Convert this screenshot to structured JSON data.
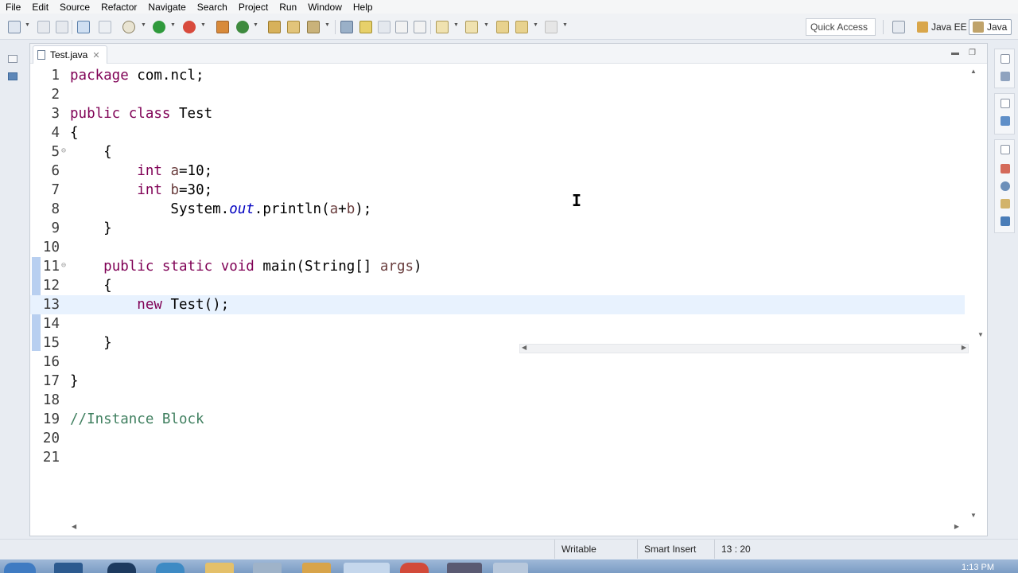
{
  "menu": [
    "File",
    "Edit",
    "Source",
    "Refactor",
    "Navigate",
    "Search",
    "Project",
    "Run",
    "Window",
    "Help"
  ],
  "toolbar": {
    "quick_access": "Quick Access",
    "perspectives": [
      "Java EE",
      "Java"
    ]
  },
  "editor": {
    "tab_label": "Test.java",
    "tab_close": "✕",
    "lines": [
      {
        "num": "1",
        "html": "<span class=\"kw\">package</span> com.ncl;"
      },
      {
        "num": "2",
        "html": ""
      },
      {
        "num": "3",
        "html": "<span class=\"kw\">public</span> <span class=\"kw\">class</span> Test"
      },
      {
        "num": "4",
        "html": "{"
      },
      {
        "num": "5",
        "html": "    {",
        "fold": "⊖"
      },
      {
        "num": "6",
        "html": "        <span class=\"kw\">int</span> <span class=\"var\">a</span>=10;"
      },
      {
        "num": "7",
        "html": "        <span class=\"kw\">int</span> <span class=\"var\">b</span>=30;"
      },
      {
        "num": "8",
        "html": "            System.<span class=\"fld\">out</span>.println(<span class=\"var\">a</span>+<span class=\"var\">b</span>);"
      },
      {
        "num": "9",
        "html": "    }"
      },
      {
        "num": "10",
        "html": ""
      },
      {
        "num": "11",
        "html": "    <span class=\"kw\">public</span> <span class=\"kw\">static</span> <span class=\"kw\">void</span> main(String[] <span class=\"var\">args</span>)",
        "fold": "⊖"
      },
      {
        "num": "12",
        "html": "    {"
      },
      {
        "num": "13",
        "html": "        <span class=\"kw\">new</span> Test();",
        "current": true
      },
      {
        "num": "14",
        "html": ""
      },
      {
        "num": "15",
        "html": "    }"
      },
      {
        "num": "16",
        "html": ""
      },
      {
        "num": "17",
        "html": "}"
      },
      {
        "num": "18",
        "html": ""
      },
      {
        "num": "19",
        "html": "<span class=\"cmt\">//Instance Block</span>"
      },
      {
        "num": "20",
        "html": ""
      },
      {
        "num": "21",
        "html": ""
      }
    ]
  },
  "status": {
    "writable": "Writable",
    "insert_mode": "Smart Insert",
    "position": "13 : 20"
  },
  "taskbar": {
    "clock": "1:13 PM"
  },
  "colors": {
    "keyword": "#7f0055",
    "field": "#0000c0",
    "variable": "#6a3e3e",
    "comment": "#3f7f5f",
    "current_line": "#e8f2fe"
  }
}
